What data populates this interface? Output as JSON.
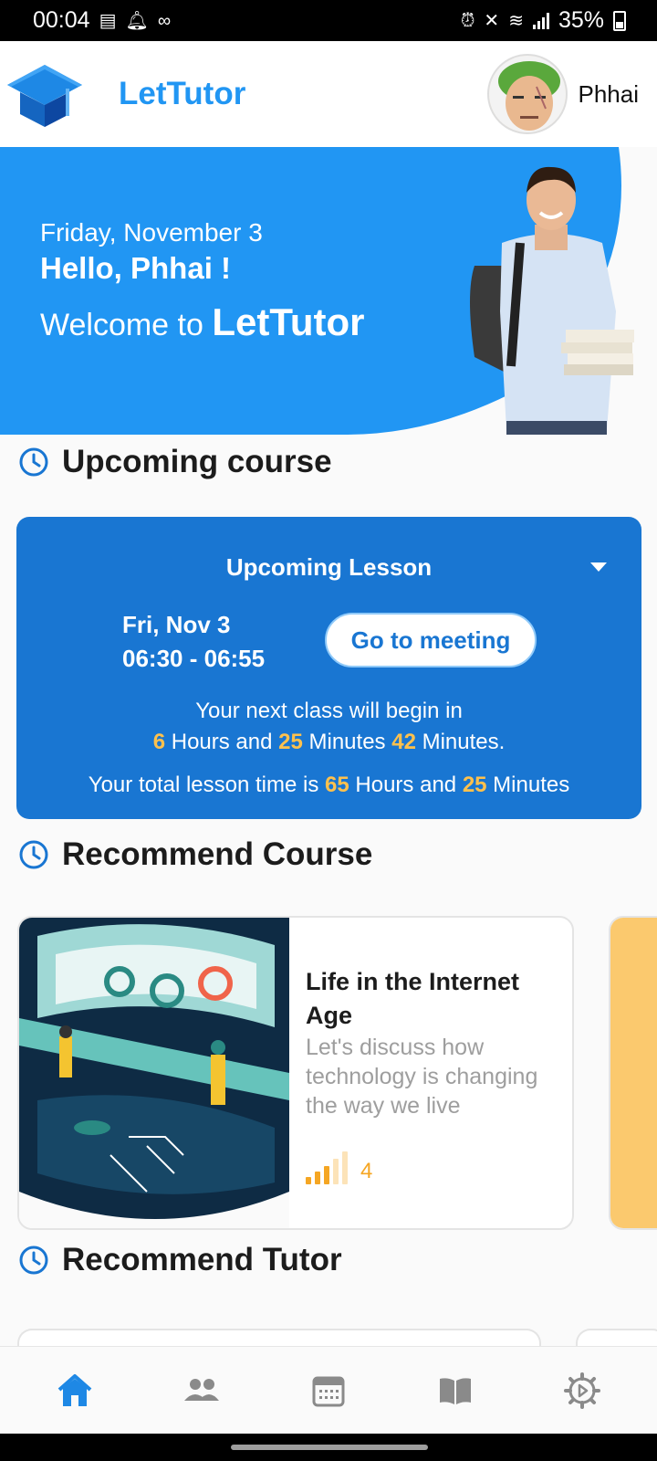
{
  "status_bar": {
    "time": "00:04",
    "battery": "35%"
  },
  "header": {
    "app_name": "LetTutor",
    "user_name": "Phhai"
  },
  "banner": {
    "date": "Friday, November 3",
    "greeting": "Hello, Phhai !",
    "welcome_prefix": "Welcome to ",
    "welcome_brand": "LetTutor"
  },
  "sections": {
    "upcoming": "Upcoming course",
    "recommend_course": "Recommend Course",
    "recommend_tutor": "Recommend Tutor"
  },
  "upcoming_lesson": {
    "title": "Upcoming Lesson",
    "date": "Fri, Nov 3",
    "time_range": "06:30 - 06:55",
    "meeting_button": "Go to meeting",
    "next_class_label": "Your next class will begin in",
    "hours": "6",
    "hours_label": " Hours and ",
    "minutes": "25",
    "minutes_label": " Minutes ",
    "seconds": "42",
    "seconds_label": " Minutes.",
    "total_prefix": "Your total lesson time is ",
    "total_hours": "65",
    "total_hours_label": " Hours and ",
    "total_minutes": "25",
    "total_minutes_label": " Minutes"
  },
  "course": {
    "title": "Life in the Internet Age",
    "description": "Let's discuss how technology is changing the way we live",
    "level": "4"
  },
  "colors": {
    "primary": "#2196f3",
    "card_blue": "#1976d2",
    "highlight": "#ffc14d",
    "level": "#f5a623"
  },
  "nav": [
    "home-icon",
    "tutors-icon",
    "schedule-icon",
    "courses-icon",
    "settings-icon"
  ]
}
